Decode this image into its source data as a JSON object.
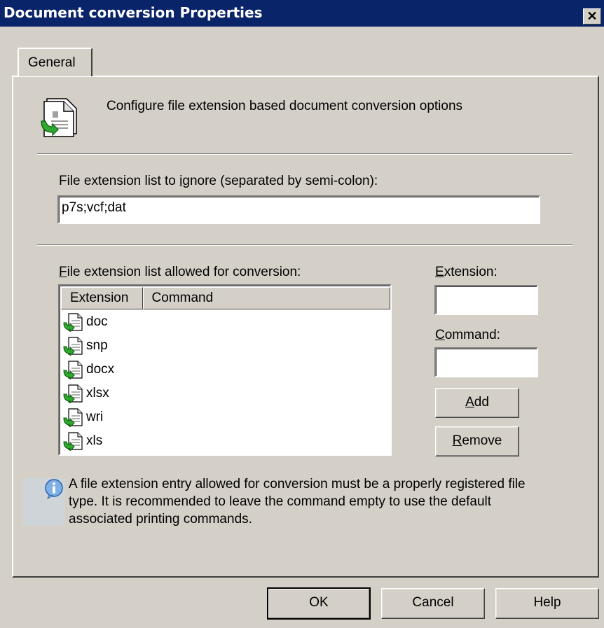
{
  "window": {
    "title": "Document conversion Properties",
    "close_icon": "close-icon",
    "close_glyph": "✕"
  },
  "tabs": [
    {
      "label": "General"
    }
  ],
  "header": {
    "icon": "document-conversion-icon",
    "text": "Configure file extension based document conversion options"
  },
  "ignore": {
    "label_pre": "File extension list to ",
    "label_u": "i",
    "label_post": "gnore (separated by semi-colon):",
    "value": "p7s;vcf;dat"
  },
  "allowed": {
    "label_u": "F",
    "label_post": "ile extension list allowed for conversion:",
    "columns": [
      "Extension",
      "Command"
    ],
    "items": [
      {
        "ext": "doc",
        "command": ""
      },
      {
        "ext": "snp",
        "command": ""
      },
      {
        "ext": "docx",
        "command": ""
      },
      {
        "ext": "xlsx",
        "command": ""
      },
      {
        "ext": "wri",
        "command": ""
      },
      {
        "ext": "xls",
        "command": ""
      }
    ]
  },
  "extension_field": {
    "label_u": "E",
    "label_post": "xtension:",
    "value": ""
  },
  "command_field": {
    "label_u": "C",
    "label_post": "ommand:",
    "value": ""
  },
  "buttons": {
    "add_u": "A",
    "add_post": "dd",
    "remove_u": "R",
    "remove_post": "emove"
  },
  "info": {
    "icon": "info-icon",
    "text": "A file extension entry allowed for conversion must be a properly registered file type. It is recommended to leave the command empty to use the default associated printing commands."
  },
  "footer": {
    "ok": "OK",
    "cancel": "Cancel",
    "help": "Help"
  },
  "colors": {
    "titlebar": "#0a246a",
    "face": "#d4d0c8",
    "accent_green": "#2ea82e"
  }
}
